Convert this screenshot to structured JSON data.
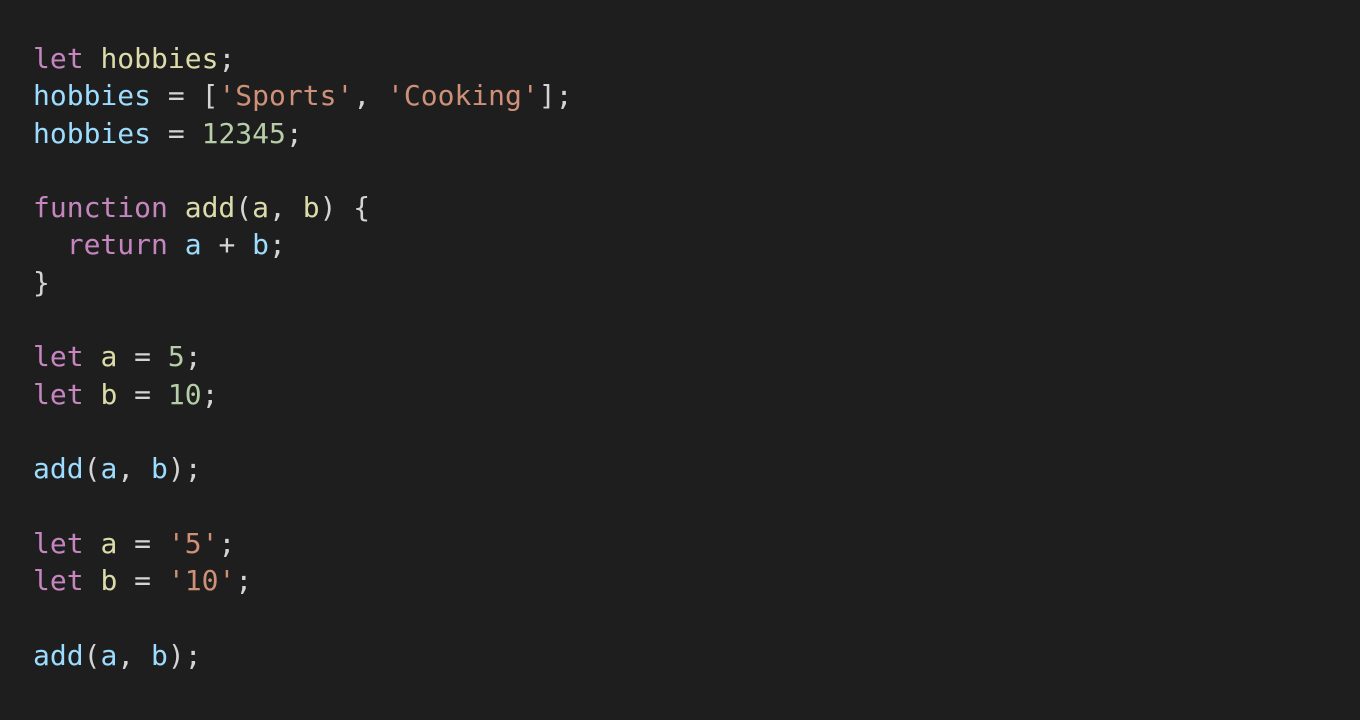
{
  "colors": {
    "background": "#1e1e1e",
    "keyword": "#c586c0",
    "declared_name": "#dcdcaa",
    "variable": "#9cdcfe",
    "string": "#ce9178",
    "number": "#b5cea8",
    "punctuation": "#d4d4d4"
  },
  "code": {
    "lines": [
      [
        {
          "t": "let",
          "c": "kw"
        },
        {
          "t": " ",
          "c": "punc"
        },
        {
          "t": "hobbies",
          "c": "decl"
        },
        {
          "t": ";",
          "c": "punc"
        }
      ],
      [
        {
          "t": "hobbies",
          "c": "var"
        },
        {
          "t": " = [",
          "c": "punc"
        },
        {
          "t": "'Sports'",
          "c": "str"
        },
        {
          "t": ", ",
          "c": "punc"
        },
        {
          "t": "'Cooking'",
          "c": "str"
        },
        {
          "t": "];",
          "c": "punc"
        }
      ],
      [
        {
          "t": "hobbies",
          "c": "var"
        },
        {
          "t": " = ",
          "c": "punc"
        },
        {
          "t": "12345",
          "c": "num"
        },
        {
          "t": ";",
          "c": "punc"
        }
      ],
      [],
      [
        {
          "t": "function",
          "c": "kw"
        },
        {
          "t": " ",
          "c": "punc"
        },
        {
          "t": "add",
          "c": "fn"
        },
        {
          "t": "(",
          "c": "punc"
        },
        {
          "t": "a",
          "c": "decl"
        },
        {
          "t": ", ",
          "c": "punc"
        },
        {
          "t": "b",
          "c": "decl"
        },
        {
          "t": ") {",
          "c": "punc"
        }
      ],
      [
        {
          "t": "  ",
          "c": "punc"
        },
        {
          "t": "return",
          "c": "kw"
        },
        {
          "t": " ",
          "c": "punc"
        },
        {
          "t": "a",
          "c": "var"
        },
        {
          "t": " + ",
          "c": "punc"
        },
        {
          "t": "b",
          "c": "var"
        },
        {
          "t": ";",
          "c": "punc"
        }
      ],
      [
        {
          "t": "}",
          "c": "punc"
        }
      ],
      [],
      [
        {
          "t": "let",
          "c": "kw"
        },
        {
          "t": " ",
          "c": "punc"
        },
        {
          "t": "a",
          "c": "decl"
        },
        {
          "t": " = ",
          "c": "punc"
        },
        {
          "t": "5",
          "c": "num"
        },
        {
          "t": ";",
          "c": "punc"
        }
      ],
      [
        {
          "t": "let",
          "c": "kw"
        },
        {
          "t": " ",
          "c": "punc"
        },
        {
          "t": "b",
          "c": "decl"
        },
        {
          "t": " = ",
          "c": "punc"
        },
        {
          "t": "10",
          "c": "num"
        },
        {
          "t": ";",
          "c": "punc"
        }
      ],
      [],
      [
        {
          "t": "add",
          "c": "var"
        },
        {
          "t": "(",
          "c": "punc"
        },
        {
          "t": "a",
          "c": "var"
        },
        {
          "t": ", ",
          "c": "punc"
        },
        {
          "t": "b",
          "c": "var"
        },
        {
          "t": ");",
          "c": "punc"
        }
      ],
      [],
      [
        {
          "t": "let",
          "c": "kw"
        },
        {
          "t": " ",
          "c": "punc"
        },
        {
          "t": "a",
          "c": "decl"
        },
        {
          "t": " = ",
          "c": "punc"
        },
        {
          "t": "'5'",
          "c": "str"
        },
        {
          "t": ";",
          "c": "punc"
        }
      ],
      [
        {
          "t": "let",
          "c": "kw"
        },
        {
          "t": " ",
          "c": "punc"
        },
        {
          "t": "b",
          "c": "decl"
        },
        {
          "t": " = ",
          "c": "punc"
        },
        {
          "t": "'10'",
          "c": "str"
        },
        {
          "t": ";",
          "c": "punc"
        }
      ],
      [],
      [
        {
          "t": "add",
          "c": "var"
        },
        {
          "t": "(",
          "c": "punc"
        },
        {
          "t": "a",
          "c": "var"
        },
        {
          "t": ", ",
          "c": "punc"
        },
        {
          "t": "b",
          "c": "var"
        },
        {
          "t": ");",
          "c": "punc"
        }
      ]
    ]
  }
}
